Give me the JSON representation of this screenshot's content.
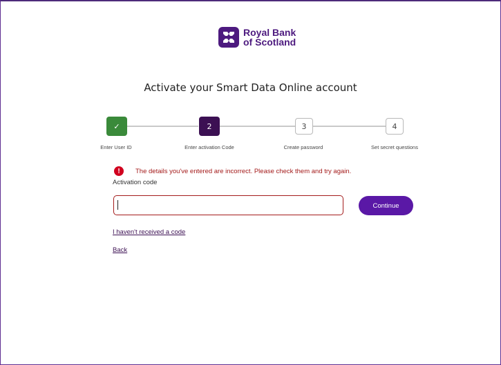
{
  "brand": {
    "name_line1": "Royal Bank",
    "name_line2": "of Scotland",
    "color": "#4d1a7f",
    "icon": "rbs-logo-icon"
  },
  "page": {
    "title": "Activate your Smart Data Online account"
  },
  "stepper": {
    "steps": [
      {
        "label": "Enter User ID",
        "marker": "✓",
        "state": "done"
      },
      {
        "label": "Enter activation Code",
        "marker": "2",
        "state": "active"
      },
      {
        "label": "Create password",
        "marker": "3",
        "state": "todo"
      },
      {
        "label": "Set secret questions",
        "marker": "4",
        "state": "todo"
      }
    ]
  },
  "form": {
    "error_icon": "!",
    "error_message": "The details you've entered are incorrect. Please check them and try again.",
    "field_label": "Activation code",
    "input_value": "",
    "continue_label": "Continue"
  },
  "links": {
    "no_code": "I haven't received a code",
    "back": "Back"
  },
  "colors": {
    "accent": "#5a18a6",
    "error": "#a31a1a",
    "success": "#3a8a3a",
    "active_step": "#3c1053"
  }
}
